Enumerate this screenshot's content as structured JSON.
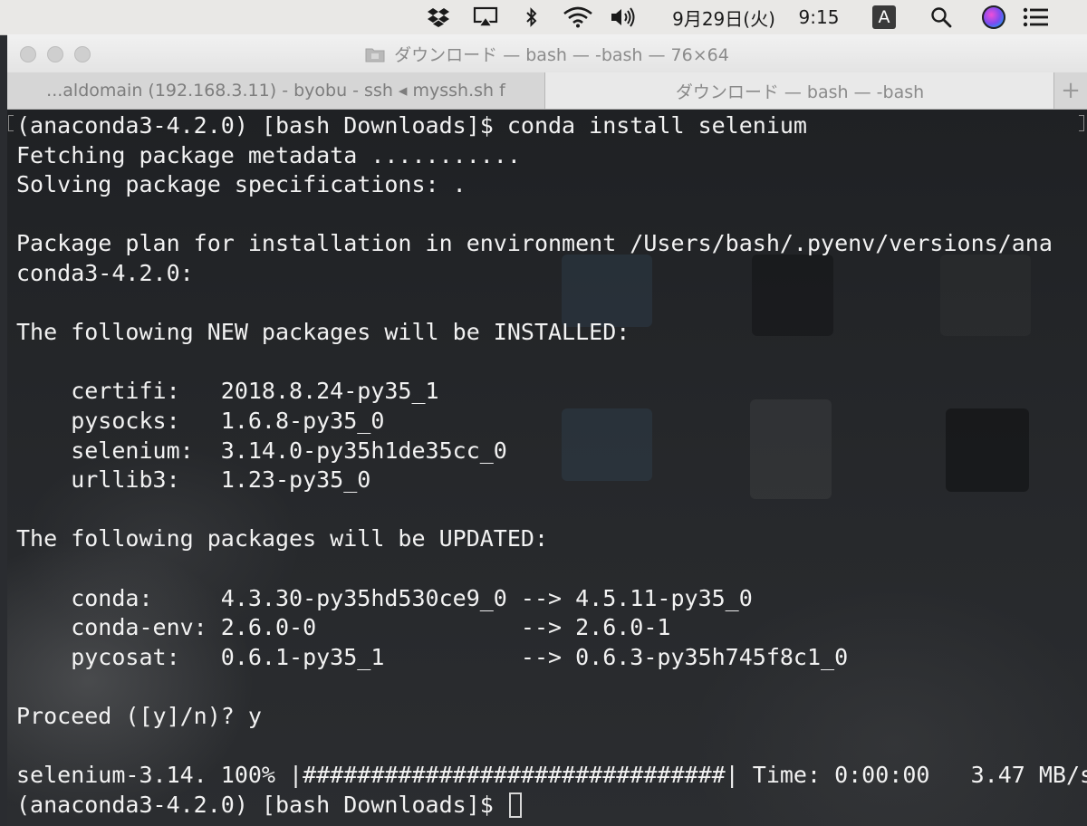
{
  "menubar": {
    "date": "9月29日(火)",
    "time": "9:15",
    "input_mode": "A",
    "icons": [
      "dropbox-icon",
      "airplay-icon",
      "bluetooth-icon",
      "wifi-icon",
      "volume-icon",
      "input-source-icon",
      "search-icon",
      "siri-icon",
      "notification-center-icon"
    ]
  },
  "window": {
    "title": "ダウンロード — bash — -bash — 76×64"
  },
  "tabs": [
    {
      "label": "...aldomain (192.168.3.11) - byobu - ssh ◂ myssh.sh f",
      "active": false
    },
    {
      "label": "ダウンロード — bash — -bash",
      "active": true
    }
  ],
  "tab_add_label": "+",
  "terminal": {
    "lines": [
      "(anaconda3-4.2.0) [bash Downloads]$ conda install selenium",
      "Fetching package metadata ...........",
      "Solving package specifications: .",
      "",
      "Package plan for installation in environment /Users/bash/.pyenv/versions/ana",
      "conda3-4.2.0:",
      "",
      "The following NEW packages will be INSTALLED:",
      "",
      "    certifi:   2018.8.24-py35_1",
      "    pysocks:   1.6.8-py35_0",
      "    selenium:  3.14.0-py35h1de35cc_0",
      "    urllib3:   1.23-py35_0",
      "",
      "The following packages will be UPDATED:",
      "",
      "    conda:     4.3.30-py35hd530ce9_0 --> 4.5.11-py35_0",
      "    conda-env: 2.6.0-0               --> 2.6.0-1",
      "    pycosat:   0.6.1-py35_1          --> 0.6.3-py35h745f8c1_0",
      "",
      "Proceed ([y]/n)? y",
      "",
      "selenium-3.14. 100% |###############################| Time: 0:00:00   3.47 MB/s",
      "(anaconda3-4.2.0) [bash Downloads]$ "
    ]
  }
}
